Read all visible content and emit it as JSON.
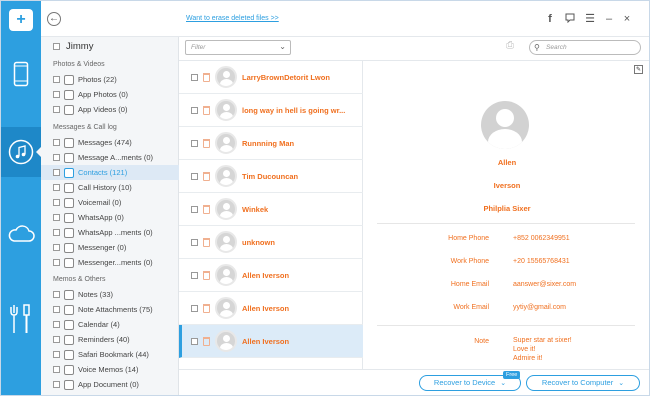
{
  "header": {
    "erase_link": "Want to erase deleted files >>"
  },
  "sidebar": {
    "owner": "Jimmy",
    "section1": "Photos & Videos",
    "section2": "Messages & Call log",
    "section3": "Memos & Others",
    "items": [
      {
        "label": "Photos (22)"
      },
      {
        "label": "App Photos (0)"
      },
      {
        "label": "App Videos (0)"
      },
      {
        "label": "Messages (474)"
      },
      {
        "label": "Message A...ments (0)"
      },
      {
        "label": "Contacts (121)"
      },
      {
        "label": "Call History (10)"
      },
      {
        "label": "Voicemail (0)"
      },
      {
        "label": "WhatsApp (0)"
      },
      {
        "label": "WhatsApp ...ments (0)"
      },
      {
        "label": "Messenger (0)"
      },
      {
        "label": "Messenger...ments (0)"
      },
      {
        "label": "Notes (33)"
      },
      {
        "label": "Note Attachments (75)"
      },
      {
        "label": "Calendar (4)"
      },
      {
        "label": "Reminders (40)"
      },
      {
        "label": "Safari Bookmark (44)"
      },
      {
        "label": "Voice Memos (14)"
      },
      {
        "label": "App Document (0)"
      }
    ]
  },
  "toolbar": {
    "filter_placeholder": "Filter",
    "search_placeholder": "Search"
  },
  "contacts": [
    {
      "name": "LarryBrownDetorit Lwon"
    },
    {
      "name": "long way in hell is going wr..."
    },
    {
      "name": "Runnning Man"
    },
    {
      "name": "Tim  Ducouncan"
    },
    {
      "name": "Winkek"
    },
    {
      "name": "unknown"
    },
    {
      "name": "Allen  Iverson"
    },
    {
      "name": "Allen  Iverson"
    },
    {
      "name": "Allen  Iverson"
    }
  ],
  "detail": {
    "first_name": "Allen",
    "last_name": "Iverson",
    "company": "Philplia Sixer",
    "fields": [
      {
        "label": "Home Phone",
        "value": "+852 0062349951"
      },
      {
        "label": "Work Phone",
        "value": "+20 15565768431"
      },
      {
        "label": "Home Email",
        "value": "aanswer@sixer.com"
      },
      {
        "label": "Work Email",
        "value": "yytiy@gmail.com"
      }
    ],
    "note_label": "Note",
    "note_lines": [
      "Super star at sixer!",
      "Love it!",
      "Admire it!"
    ]
  },
  "footer": {
    "recover_device": "Recover to Device",
    "free_badge": "Free",
    "recover_computer": "Recover to Computer"
  },
  "colors": {
    "accent": "#2d9fe0",
    "contact_text": "#f07020"
  }
}
